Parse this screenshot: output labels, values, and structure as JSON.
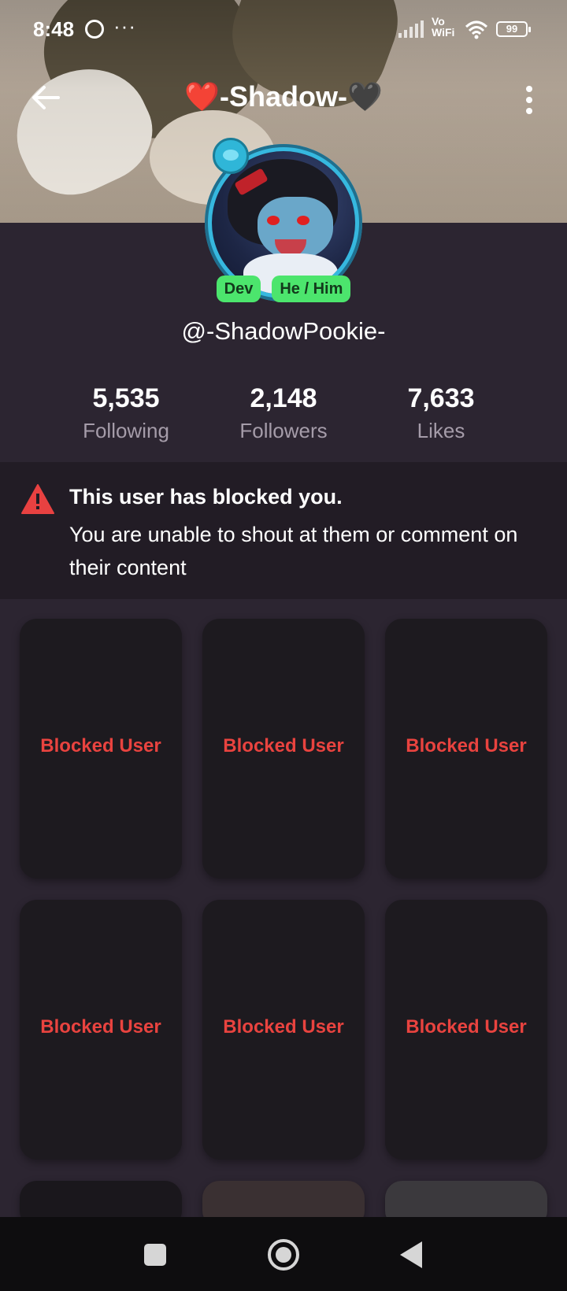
{
  "status_bar": {
    "time": "8:48",
    "dots": "···",
    "vo": "Vo",
    "wifi_text": "WiFi",
    "battery": "99"
  },
  "header": {
    "title": "❤️-Shadow-🖤"
  },
  "profile": {
    "handle": "@-ShadowPookie-",
    "tags": [
      "Dev",
      "He / Him"
    ],
    "tag_color": "#4ce56d"
  },
  "stats": [
    {
      "value": "5,535",
      "label": "Following"
    },
    {
      "value": "2,148",
      "label": "Followers"
    },
    {
      "value": "7,633",
      "label": "Likes"
    }
  ],
  "notice": {
    "title": "This user has blocked you.",
    "body": "You are unable to shout at them or comment on their content",
    "icon": "warning-icon",
    "icon_color": "#e84141"
  },
  "grid": {
    "tile_label": "Blocked User",
    "label_color": "#e9433f",
    "tiles": [
      "Blocked User",
      "Blocked User",
      "Blocked User",
      "Blocked User",
      "Blocked User",
      "Blocked User"
    ]
  },
  "nav": {
    "icons": [
      "recents-icon",
      "home-icon",
      "back-icon"
    ]
  }
}
